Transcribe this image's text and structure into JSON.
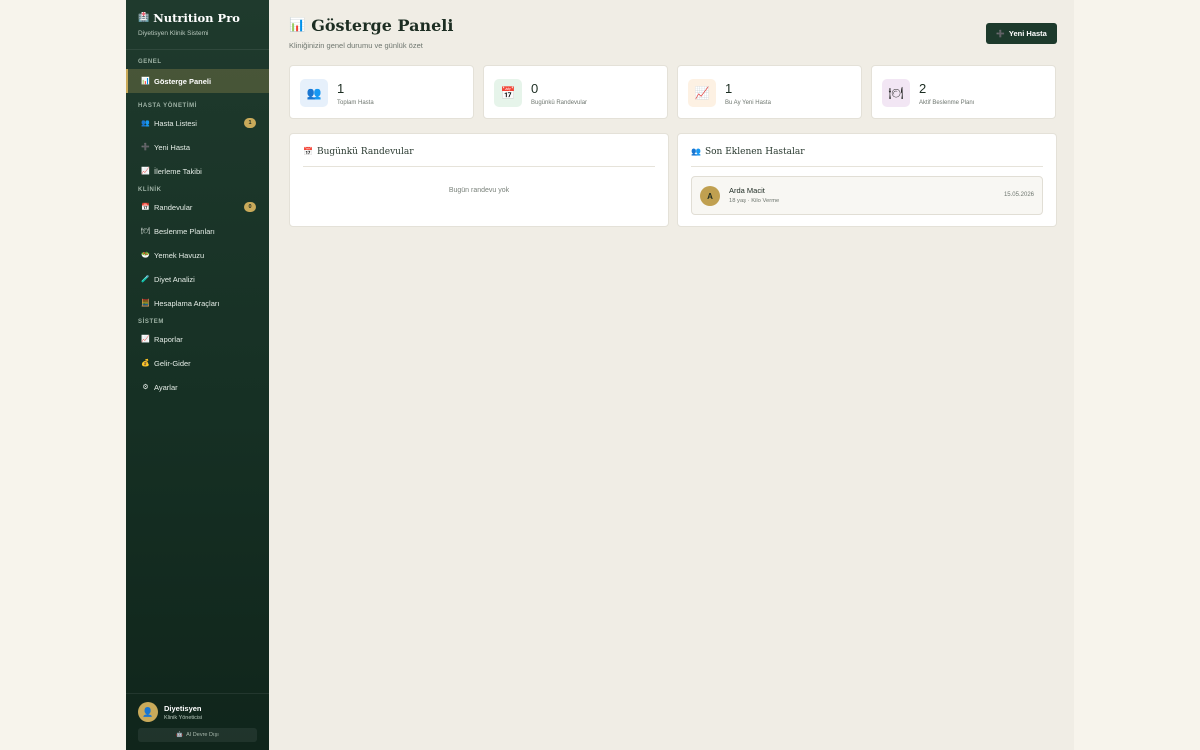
{
  "sidebar": {
    "brand_icon": "🏥",
    "brand_title": "Nutrition Pro",
    "brand_subtitle": "Diyetisyen Klinik Sistemi",
    "sections": [
      {
        "label": "GENEL"
      },
      {
        "label": "HASTA YÖNETİMİ"
      },
      {
        "label": "KLİNİK"
      },
      {
        "label": "SİSTEM"
      }
    ],
    "items": [
      {
        "label": "Gösterge Paneli",
        "icon": "📊"
      },
      {
        "label": "Hasta Listesi",
        "icon": "👥",
        "badge": "1"
      },
      {
        "label": "Yeni Hasta",
        "icon": "➕"
      },
      {
        "label": "İlerleme Takibi",
        "icon": "📈"
      },
      {
        "label": "Randevular",
        "icon": "📅",
        "badge": "0"
      },
      {
        "label": "Beslenme Planları",
        "icon": "🍽"
      },
      {
        "label": "Yemek Havuzu",
        "icon": "🥗"
      },
      {
        "label": "Diyet Analizi",
        "icon": "🧪"
      },
      {
        "label": "Hesaplama Araçları",
        "icon": "🧮"
      },
      {
        "label": "Raporlar",
        "icon": "📈"
      },
      {
        "label": "Gelir-Gider",
        "icon": "💰"
      },
      {
        "label": "Ayarlar",
        "icon": "⚙"
      }
    ],
    "user": {
      "avatar": "👤",
      "name": "Diyetisyen",
      "role": "Klinik Yöneticisi",
      "ai_icon": "🤖",
      "ai_label": "AI Devre Dışı"
    }
  },
  "header": {
    "title_icon": "📊",
    "title": "Gösterge Paneli",
    "subtitle": "Kliniğinizin genel durumu ve günlük özet",
    "new_button_icon": "➕",
    "new_button_label": "Yeni Hasta"
  },
  "stats": [
    {
      "icon": "👥",
      "value": "1",
      "label": "Toplam Hasta",
      "color": "#e6f0fb"
    },
    {
      "icon": "📅",
      "value": "0",
      "label": "Bugünkü Randevular",
      "color": "#e6f4ea"
    },
    {
      "icon": "📈",
      "value": "1",
      "label": "Bu Ay Yeni Hasta",
      "color": "#fdf1e3"
    },
    {
      "icon": "🍽",
      "value": "2",
      "label": "Aktif Beslenme Planı",
      "color": "#f2e6f4"
    }
  ],
  "panels": {
    "appointments": {
      "icon": "📅",
      "title": "Bugünkü Randevular",
      "empty_text": "Bugün randevu yok"
    },
    "recent": {
      "icon": "👥",
      "title": "Son Eklenen Hastalar",
      "patients": [
        {
          "initial": "A",
          "name": "Arda Macit",
          "meta": "18 yaş · Kilo Verme",
          "date": "15.05.2026"
        }
      ]
    }
  },
  "colors": {
    "sidebar": "#1d3a2c",
    "accent": "#c9aa5a",
    "background": "#f0ede5"
  }
}
